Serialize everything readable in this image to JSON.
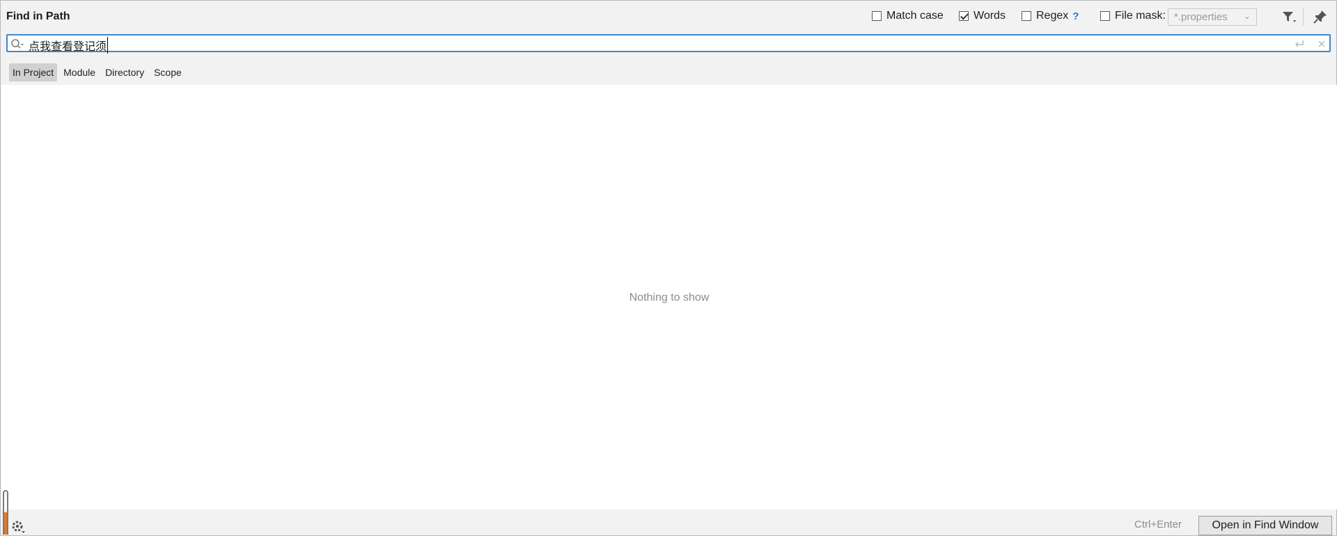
{
  "dialog": {
    "title": "Find in Path"
  },
  "options": {
    "match_case": {
      "label": "Match case",
      "checked": false
    },
    "words": {
      "label": "Words",
      "checked": true
    },
    "regex": {
      "label": "Regex",
      "help": "?",
      "checked": false
    },
    "file_mask": {
      "label": "File mask:",
      "checked": false,
      "value": "*.properties"
    }
  },
  "search": {
    "query": "点我查看登记须"
  },
  "scopes": [
    {
      "label": "In Project",
      "active": true
    },
    {
      "label": "Module",
      "active": false
    },
    {
      "label": "Directory",
      "active": false
    },
    {
      "label": "Scope",
      "active": false
    }
  ],
  "results": {
    "empty_text": "Nothing to show"
  },
  "footer": {
    "shortcut": "Ctrl+Enter",
    "open_button": "Open in Find Window"
  },
  "colors": {
    "accent": "#3d87cf",
    "handle": "#e3772b"
  }
}
